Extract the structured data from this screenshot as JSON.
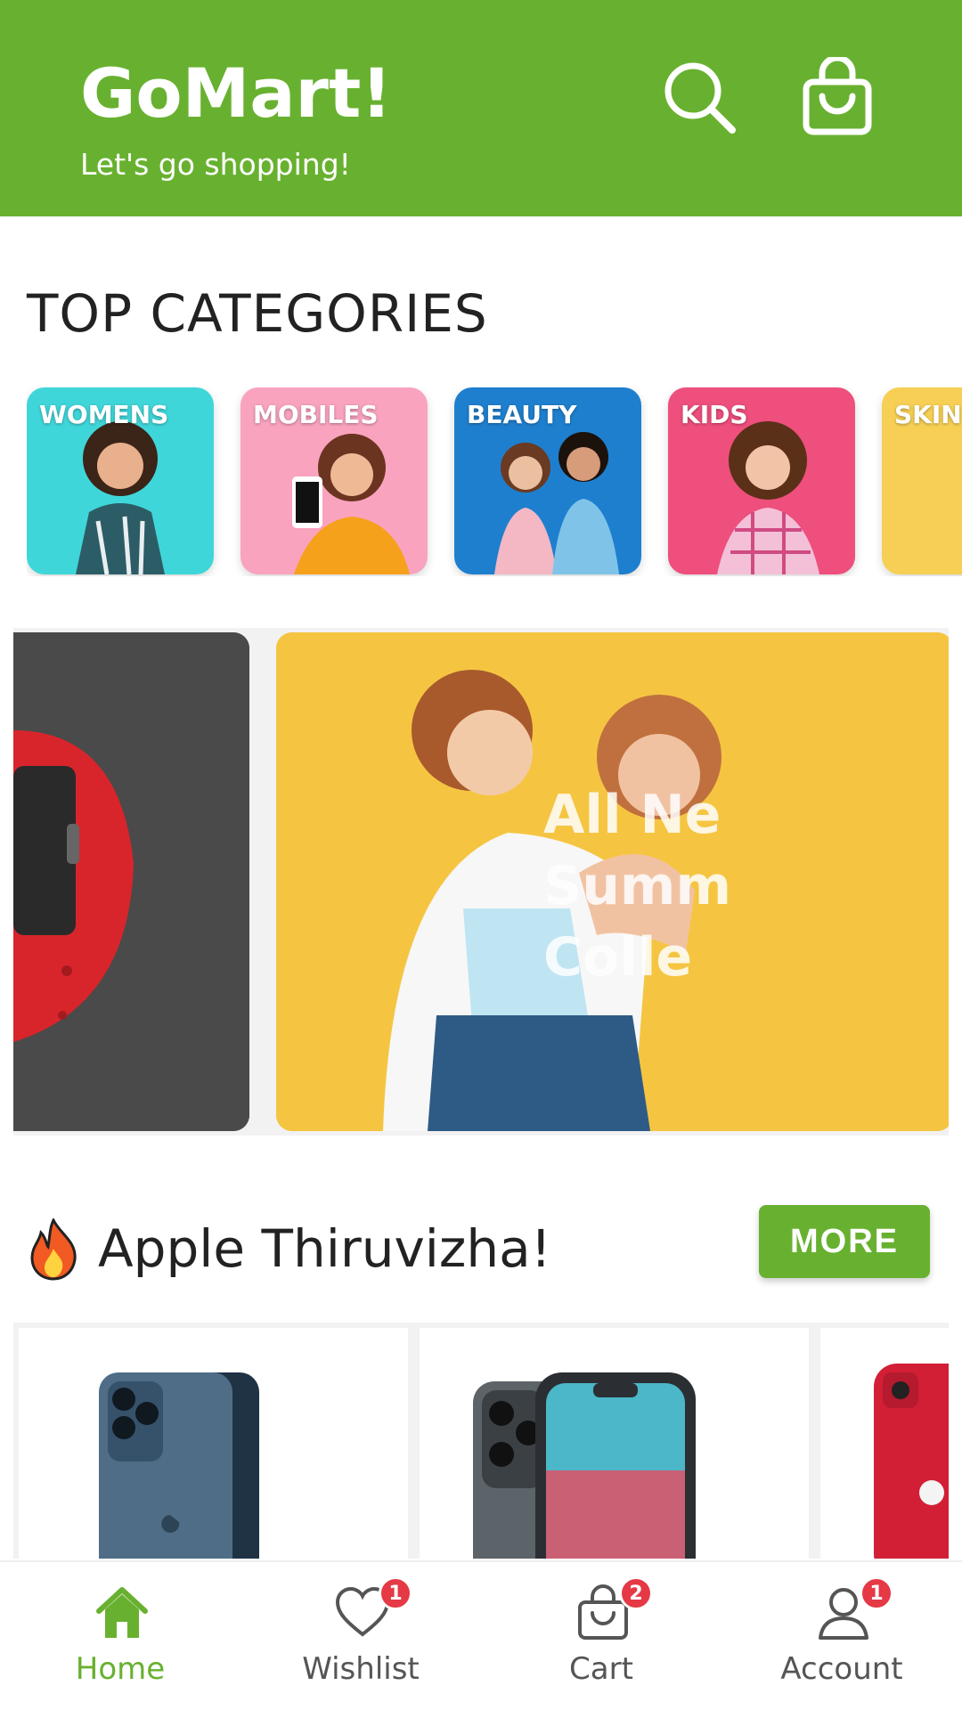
{
  "header": {
    "title": "GoMart!",
    "subtitle": "Let's go shopping!",
    "bg_color": "#68b130",
    "icons": [
      "search-icon",
      "shopping-bag-icon"
    ]
  },
  "categories": {
    "title": "TOP CATEGORIES",
    "items": [
      {
        "label": "WOMENS",
        "color": "#3fd6d9"
      },
      {
        "label": "MOBILES",
        "color": "#f9a3bf"
      },
      {
        "label": "BEAUTY",
        "color": "#1e7fcf"
      },
      {
        "label": "KIDS",
        "color": "#ee4f7c"
      },
      {
        "label": "SKIN",
        "color": "#f6cf54"
      }
    ]
  },
  "banner": {
    "text_lines": [
      "All Ne",
      "Summ",
      "Colle"
    ]
  },
  "deals": {
    "title": "Apple Thiruvizha!",
    "more_label": "MORE",
    "icon": "fire-icon"
  },
  "bottom_nav": {
    "items": [
      {
        "label": "Home",
        "icon": "home-icon",
        "active": true,
        "badge": ""
      },
      {
        "label": "Wishlist",
        "icon": "heart-icon",
        "active": false,
        "badge": "1"
      },
      {
        "label": "Cart",
        "icon": "cart-bag-icon",
        "active": false,
        "badge": "2"
      },
      {
        "label": "Account",
        "icon": "user-icon",
        "active": false,
        "badge": "1"
      }
    ]
  }
}
